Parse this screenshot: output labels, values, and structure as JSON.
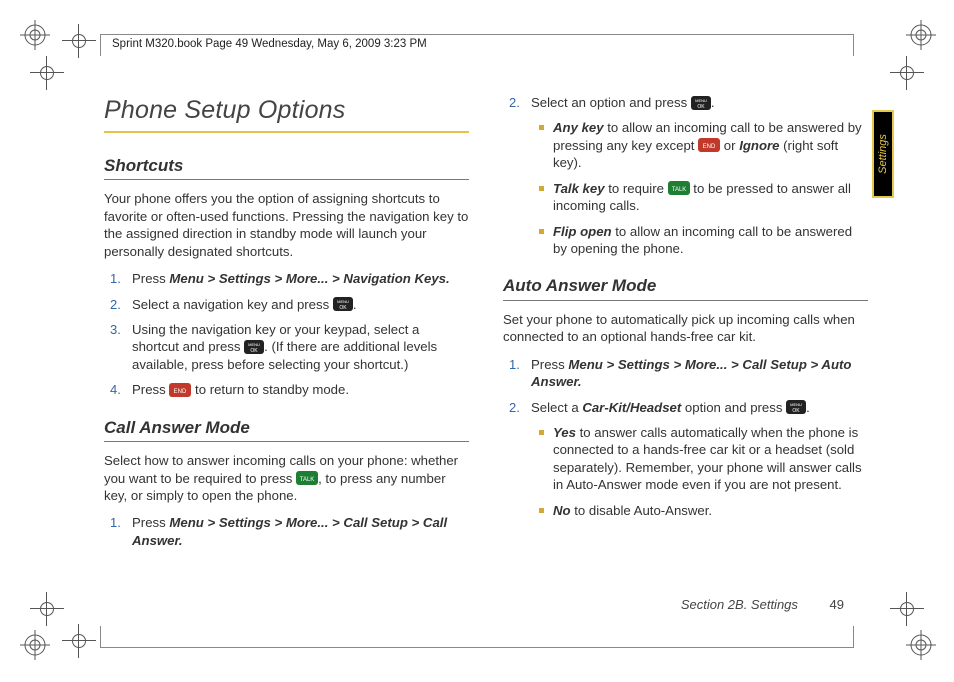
{
  "header_stamp": "Sprint M320.book  Page 49  Wednesday, May 6, 2009  3:23 PM",
  "title": "Phone Setup Options",
  "side_tab": "Settings",
  "footer_section": "Section 2B. Settings",
  "footer_page": "49",
  "left": {
    "shortcuts_h": "Shortcuts",
    "shortcuts_p": "Your phone offers you the option of assigning shortcuts to favorite or often-used functions. Pressing the navigation key to the assigned direction in standby mode will launch your personally designated shortcuts.",
    "s1_a": "Press ",
    "s1_b": "Menu > Settings > More... > Navigation Keys.",
    "s2_a": "Select a navigation key and press ",
    "s2_b": ".",
    "s3_a": "Using the navigation key or your keypad, select a shortcut and press ",
    "s3_b": ". (If there are additional levels available, press before selecting your shortcut.)",
    "s4_a": "Press ",
    "s4_b": " to return to standby mode.",
    "cam_h": "Call Answer Mode",
    "cam_p_a": "Select how to answer incoming calls on your phone: whether you want to be required to press ",
    "cam_p_b": ", to press any number key, or simply to open the phone.",
    "c1_a": "Press ",
    "c1_b": "Menu > Settings > More... > Call Setup > Call Answer."
  },
  "right": {
    "r2_a": "Select an option and press ",
    "r2_b": ".",
    "opt_any_label": "Any key",
    "opt_any_a": " to allow an incoming call to be answered by pressing any key except ",
    "opt_any_b": " or ",
    "opt_any_ignore": "Ignore",
    "opt_any_c": " (right soft key).",
    "opt_talk_label": "Talk key",
    "opt_talk_a": " to require ",
    "opt_talk_b": " to be pressed to answer all incoming calls.",
    "opt_flip_label": "Flip open",
    "opt_flip_a": " to allow an incoming call to be answered by opening the phone.",
    "aam_h": "Auto Answer Mode",
    "aam_p": "Set your phone to automatically pick up incoming calls when connected to an optional hands-free car kit.",
    "a1_a": "Press ",
    "a1_b": "Menu > Settings > More... > Call Setup > Auto Answer.",
    "a2_a": "Select a ",
    "a2_carkit": "Car-Kit/Headset",
    "a2_b": " option and press ",
    "a2_c": ".",
    "opt_yes_label": "Yes",
    "opt_yes_a": " to answer calls automatically when the phone is connected to a hands-free car kit or a headset (sold separately). Remember, your phone will answer calls in Auto-Answer mode even if you are not present.",
    "opt_no_label": "No",
    "opt_no_a": " to disable Auto-Answer."
  }
}
